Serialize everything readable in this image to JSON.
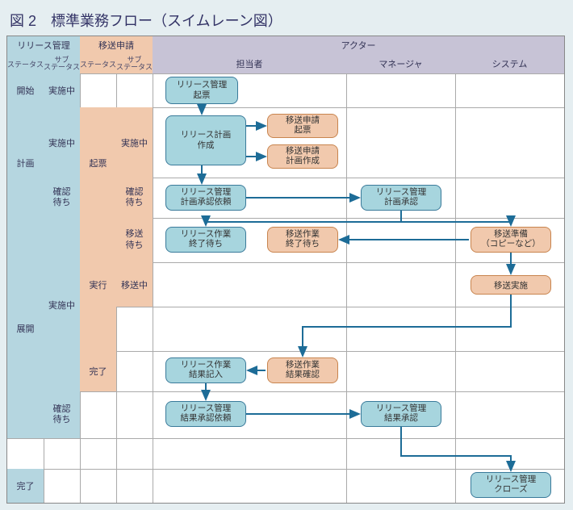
{
  "title": "図 2　標準業務フロー（スイムレーン図）",
  "lanes": {
    "release_mgmt": "リリース管理",
    "transfer_req": "移送申請",
    "actor": "アクター",
    "status": "ステータス",
    "sub_status": [
      "サブ",
      "ステータス"
    ],
    "assignee": "担当者",
    "manager": "マネージャ",
    "system": "システム"
  },
  "rows": {
    "start": "開始",
    "plan": "計画",
    "deploy": "展開",
    "done": "完了",
    "in_progress": "実施中",
    "waiting_confirm": [
      "確認",
      "待ち"
    ],
    "draft": "起票",
    "exec": "実行",
    "transfer_wait": [
      "移送",
      "待ち"
    ],
    "transferring": "移送中",
    "complete": "完了"
  },
  "boxes": {
    "release_draft": [
      "リリース管理",
      "起票"
    ],
    "release_plan_create": [
      "リリース計画",
      "作成"
    ],
    "transfer_req_draft": [
      "移送申請",
      "起票"
    ],
    "transfer_req_plan": [
      "移送申請",
      "計画作成"
    ],
    "plan_approve_req": [
      "リリース管理",
      "計画承認依頼"
    ],
    "plan_approve": [
      "リリース管理",
      "計画承認"
    ],
    "work_wait": [
      "リリース作業",
      "終了待ち"
    ],
    "transfer_work_wait": [
      "移送作業",
      "終了待ち"
    ],
    "transfer_prep": [
      "移送準備",
      "（コピーなど）"
    ],
    "transfer_exec": "移送実施",
    "work_result_entry": [
      "リリース作業",
      "結果記入"
    ],
    "transfer_result_confirm": [
      "移送作業",
      "結果確認"
    ],
    "result_approve_req": [
      "リリース管理",
      "結果承認依頼"
    ],
    "result_approve": [
      "リリース管理",
      "結果承認"
    ],
    "release_close": [
      "リリース管理",
      "クローズ"
    ]
  }
}
